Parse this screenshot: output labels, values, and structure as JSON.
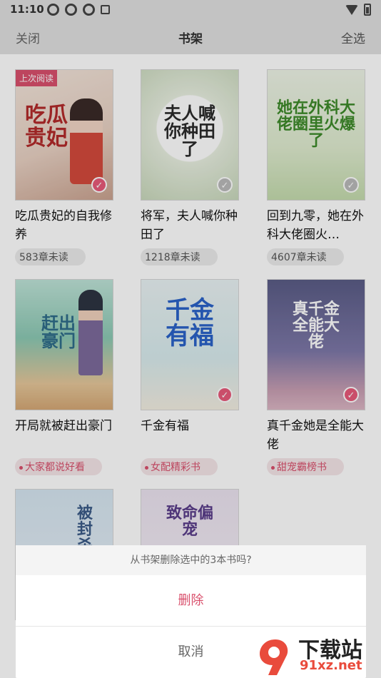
{
  "status": {
    "time": "11:10"
  },
  "header": {
    "left": "关闭",
    "title": "书架",
    "right": "全选"
  },
  "books": [
    {
      "title": "吃瓜贵妃的自我修养",
      "cover_text": "吃瓜贵妃",
      "meta": "583章未读",
      "last_read": "上次阅读",
      "selected": true
    },
    {
      "title": "将军，夫人喊你种田了",
      "cover_text": "夫人喊你种田了",
      "meta": "1218章未读",
      "selected": false
    },
    {
      "title": "回到九零，她在外科大佬圈火…",
      "cover_text": "她在外科大佬圈里火爆了",
      "meta": "4607章未读",
      "selected": false
    },
    {
      "title": "开局就被赶出豪门",
      "cover_text": "赶出豪门",
      "meta": "大家都说好看",
      "selected": false
    },
    {
      "title": "千金有福",
      "cover_text": "千金有福",
      "meta": "女配精彩书",
      "selected": true
    },
    {
      "title": "真千金她是全能大佬",
      "cover_text": "真千金全能大佬",
      "meta": "甜宠霸榜书",
      "selected": true
    },
    {
      "title": "",
      "cover_text": "被封杀"
    },
    {
      "title": "",
      "cover_text": "致命偏宠"
    }
  ],
  "dialog": {
    "message": "从书架删除选中的3本书吗?",
    "delete": "删除",
    "cancel": "取消"
  },
  "watermark": {
    "brand": "下载站",
    "url": "91xz.net"
  },
  "colors": {
    "accent": "#d9506c",
    "header_bg": "#e0e0e0"
  }
}
